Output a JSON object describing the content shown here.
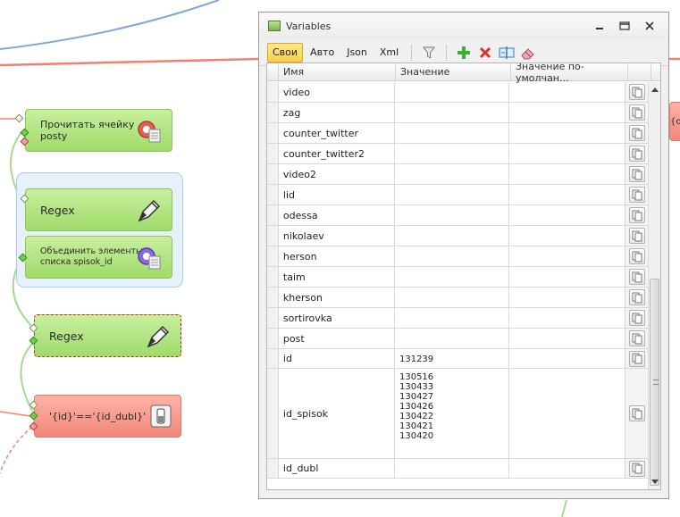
{
  "window": {
    "title": "Variables"
  },
  "toolbar": {
    "tabs": [
      "Свои",
      "Авто",
      "Json",
      "Xml"
    ],
    "icons": [
      "filter-icon",
      "add-icon",
      "delete-icon",
      "edit-icon",
      "eraser-icon"
    ]
  },
  "table": {
    "columns": [
      "Имя",
      "Значение",
      "Значение по-умолчан..."
    ],
    "rows": [
      {
        "name": "video",
        "value": []
      },
      {
        "name": "zag",
        "value": []
      },
      {
        "name": "counter_twitter",
        "value": []
      },
      {
        "name": "counter_twitter2",
        "value": []
      },
      {
        "name": "video2",
        "value": []
      },
      {
        "name": "lid",
        "value": []
      },
      {
        "name": "odessa",
        "value": []
      },
      {
        "name": "nikolaev",
        "value": []
      },
      {
        "name": "herson",
        "value": []
      },
      {
        "name": "taim",
        "value": []
      },
      {
        "name": "kherson",
        "value": []
      },
      {
        "name": "sortirovka",
        "value": []
      },
      {
        "name": "post",
        "value": []
      },
      {
        "name": "id",
        "value": [
          "131239"
        ]
      },
      {
        "name": "id_spisok",
        "value": [
          "130516",
          "130433",
          "130427",
          "130426",
          "130422",
          "130421",
          "130420"
        ]
      },
      {
        "name": "id_dubl",
        "value": []
      }
    ]
  },
  "canvas": {
    "nodes": {
      "read_cell": "Прочитать ячейку\nposty",
      "regex1": "Regex",
      "merge": "Объединить элементы\nсписка spisok_id",
      "regex2": "Regex",
      "compare": "'{id}'=='{id_dubl}'",
      "clipped": "{od"
    }
  },
  "colors": {
    "node_green": "#a6de72",
    "node_red": "#f48e80",
    "group_bg": "#e6f1fb",
    "active_tab": "#f7cf4a"
  }
}
